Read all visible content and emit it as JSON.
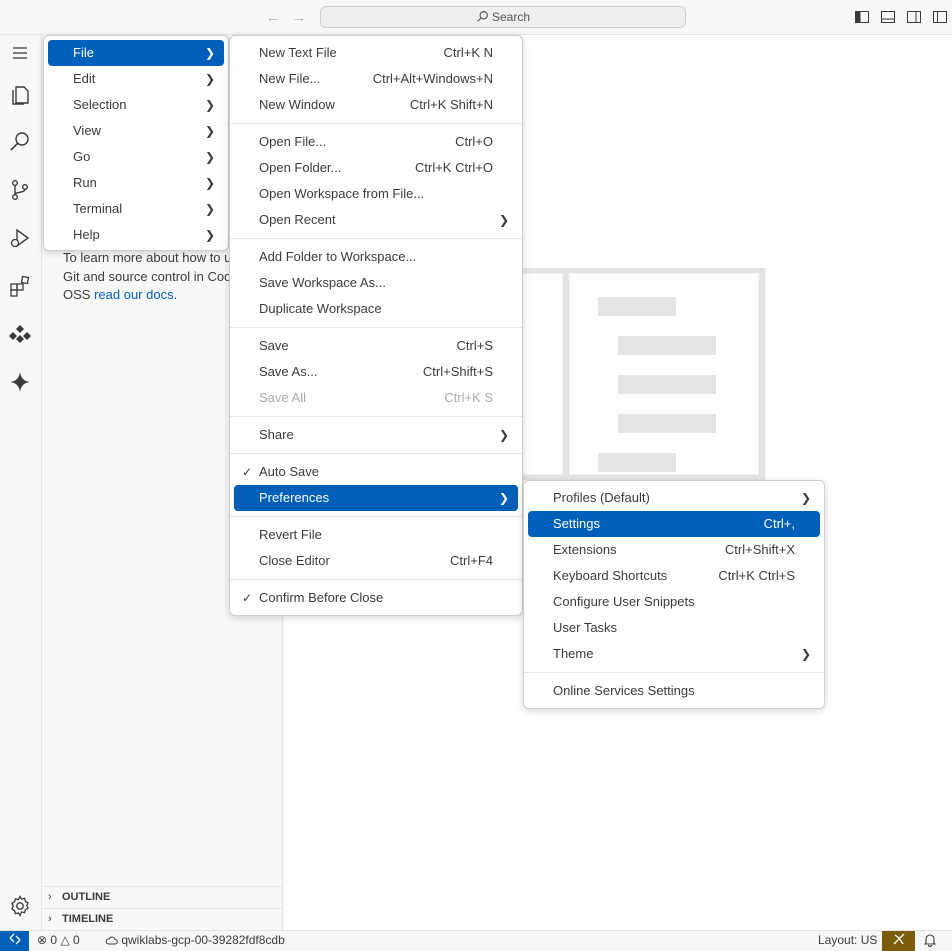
{
  "titlebar": {
    "search_label": "Search"
  },
  "sidebar": {
    "text_line1": "To learn more about how to use",
    "text_line2": "Git and source control in Code -",
    "text_line3_prefix": "OSS ",
    "docs_link": "read our docs",
    "text_line3_suffix": ".",
    "outline_label": "OUTLINE",
    "timeline_label": "TIMELINE"
  },
  "menubar": {
    "items": [
      {
        "label": "File"
      },
      {
        "label": "Edit"
      },
      {
        "label": "Selection"
      },
      {
        "label": "View"
      },
      {
        "label": "Go"
      },
      {
        "label": "Run"
      },
      {
        "label": "Terminal"
      },
      {
        "label": "Help"
      }
    ]
  },
  "file_menu": {
    "groups": [
      [
        {
          "label": "New Text File",
          "shortcut": "Ctrl+K N"
        },
        {
          "label": "New File...",
          "shortcut": "Ctrl+Alt+Windows+N"
        },
        {
          "label": "New Window",
          "shortcut": "Ctrl+K Shift+N"
        }
      ],
      [
        {
          "label": "Open File...",
          "shortcut": "Ctrl+O"
        },
        {
          "label": "Open Folder...",
          "shortcut": "Ctrl+K Ctrl+O"
        },
        {
          "label": "Open Workspace from File...",
          "shortcut": ""
        },
        {
          "label": "Open Recent",
          "shortcut": ""
        }
      ],
      [
        {
          "label": "Add Folder to Workspace...",
          "shortcut": ""
        },
        {
          "label": "Save Workspace As...",
          "shortcut": ""
        },
        {
          "label": "Duplicate Workspace",
          "shortcut": ""
        }
      ],
      [
        {
          "label": "Save",
          "shortcut": "Ctrl+S"
        },
        {
          "label": "Save As...",
          "shortcut": "Ctrl+Shift+S"
        },
        {
          "label": "Save All",
          "shortcut": "Ctrl+K S"
        }
      ],
      [
        {
          "label": "Share",
          "shortcut": ""
        }
      ],
      [
        {
          "label": "Auto Save",
          "shortcut": ""
        },
        {
          "label": "Preferences",
          "shortcut": ""
        }
      ],
      [
        {
          "label": "Revert File",
          "shortcut": ""
        },
        {
          "label": "Close Editor",
          "shortcut": "Ctrl+F4"
        }
      ],
      [
        {
          "label": "Confirm Before Close",
          "shortcut": ""
        }
      ]
    ]
  },
  "preferences_menu": {
    "items": [
      {
        "label": "Profiles (Default)",
        "shortcut": ""
      },
      {
        "label": "Settings",
        "shortcut": "Ctrl+,"
      },
      {
        "label": "Extensions",
        "shortcut": "Ctrl+Shift+X"
      },
      {
        "label": "Keyboard Shortcuts",
        "shortcut": "Ctrl+K Ctrl+S"
      },
      {
        "label": "Configure User Snippets",
        "shortcut": ""
      },
      {
        "label": "User Tasks",
        "shortcut": ""
      },
      {
        "label": "Theme",
        "shortcut": ""
      },
      {
        "label": "Online Services Settings",
        "shortcut": ""
      }
    ]
  },
  "statusbar": {
    "errors": "0",
    "warnings": "0",
    "project": "qwiklabs-gcp-00-39282fdf8cdb",
    "layout": "Layout: US"
  },
  "colors": {
    "accent": "#005fb8",
    "feedback": "#7a5c0a"
  }
}
